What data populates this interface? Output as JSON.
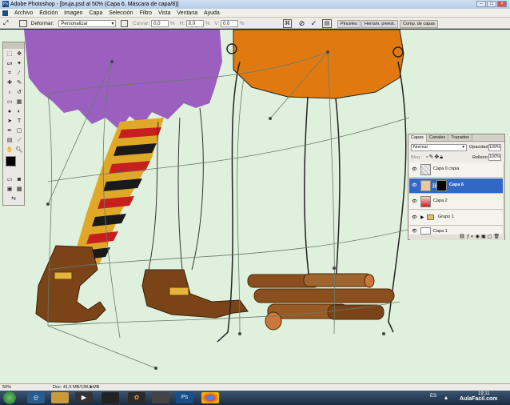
{
  "window": {
    "title": "Adobe Photoshop - [bruja.psd al 50% (Capa 6, Máscara de capa/8)]"
  },
  "menu": [
    "Archivo",
    "Edición",
    "Imagen",
    "Capa",
    "Selección",
    "Filtro",
    "Vista",
    "Ventana",
    "Ayuda"
  ],
  "options": {
    "deformar_label": "Deformar:",
    "mode_value": "Personalizar",
    "curvar_label": "Curvar:",
    "curvar_value": "0,0",
    "percent": "%",
    "h_label": "H:",
    "h_value": "0,0",
    "v_label": "V:",
    "v_value": "0,0"
  },
  "palette_tabs": [
    "Pinceles",
    "Herram. preest.",
    "Comp. de capas"
  ],
  "layers_panel": {
    "tabs": [
      "Capas",
      "Canales",
      "Trazados"
    ],
    "blend_mode": "Normal",
    "opacity_label": "Opacidad:",
    "opacity_value": "100%",
    "lock_label": "Bloq.:",
    "fill_label": "Relleno:",
    "fill_value": "100%",
    "layers": [
      {
        "name": "Capa 0 copia",
        "selected": false
      },
      {
        "name": "Capa 6",
        "selected": true
      },
      {
        "name": "Capa 2",
        "selected": false
      },
      {
        "name": "Grupo 1",
        "selected": false
      },
      {
        "name": "Capa 1",
        "selected": false
      }
    ]
  },
  "status": {
    "zoom": "50%",
    "doc": "Doc: 41,5 MB/138,0 MB"
  },
  "taskbar": {
    "lang": "ES",
    "clock_time": "19:11",
    "watermark": "AulaFacil.com"
  },
  "colors": {
    "canvas_bg": "#dff1dc",
    "dress_purple": "#9b5fc0",
    "pot_orange": "#e07a10",
    "boot_brown": "#7a4418",
    "wood_brown": "#8b4f1f",
    "stripe_red": "#c71f1f",
    "stripe_yellow": "#f0b030",
    "selection_blue": "#3168c6"
  }
}
